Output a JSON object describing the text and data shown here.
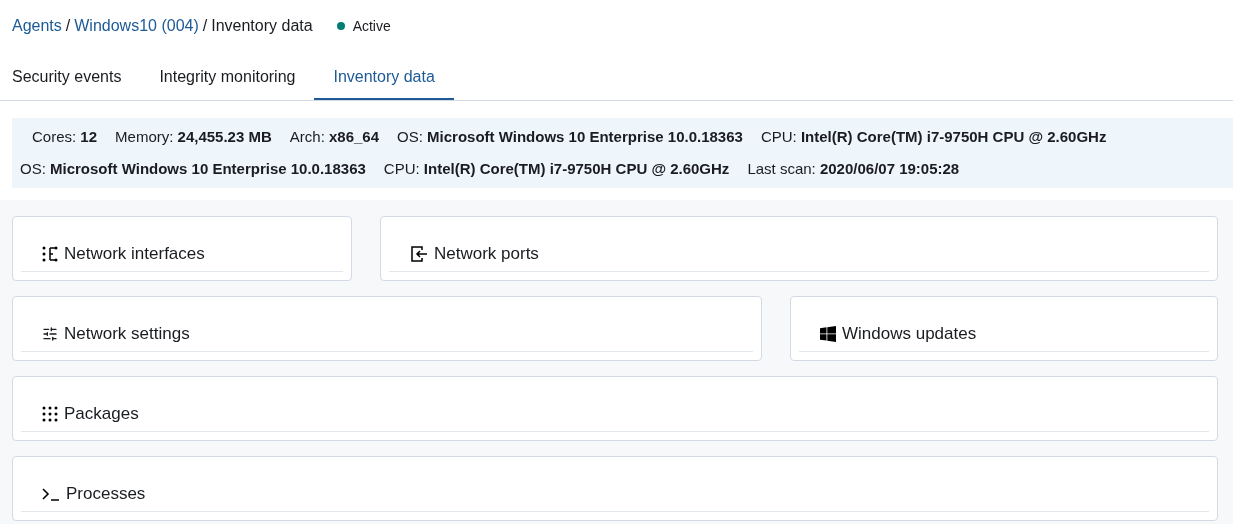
{
  "breadcrumb": [
    {
      "text": "Agents",
      "link": true
    },
    {
      "text": "/",
      "link": false
    },
    {
      "text": "Windows10 (004)",
      "link": true
    },
    {
      "text": "/",
      "link": false
    },
    {
      "text": "Inventory data",
      "link": false
    }
  ],
  "status": {
    "label": "Active"
  },
  "tabs": [
    {
      "label": "Security events",
      "selected": false
    },
    {
      "label": "Integrity monitoring",
      "selected": false
    },
    {
      "label": "Inventory data",
      "selected": true
    }
  ],
  "info_lines": [
    [
      {
        "label": "Cores:",
        "value": "12"
      },
      {
        "label": "Memory:",
        "value": "24,455.23 MB"
      },
      {
        "label": "Arch:",
        "value": "x86_64"
      },
      {
        "label": "OS:",
        "value": "Microsoft Windows 10 Enterprise 10.0.18363"
      },
      {
        "label": "CPU:",
        "value": "Intel(R) Core(TM) i7-9750H CPU @ 2.60GHz"
      }
    ],
    [
      {
        "label": "OS:",
        "value": "Microsoft Windows 10 Enterprise 10.0.18363"
      },
      {
        "label": "CPU:",
        "value": "Intel(R) Core(TM) i7-9750H CPU @ 2.60GHz"
      },
      {
        "label": "Last scan:",
        "value": "2020/06/07 19:05:28"
      }
    ]
  ],
  "card_rows": [
    [
      {
        "title": "Network interfaces",
        "kind": "interfaces"
      },
      {
        "title": "Network ports",
        "kind": "ports"
      }
    ],
    [
      {
        "title": "Network settings",
        "kind": "settings"
      },
      {
        "title": "Windows updates",
        "kind": "windows"
      }
    ],
    [
      {
        "title": "Packages",
        "kind": "packages"
      }
    ],
    [
      {
        "title": "Processes",
        "kind": "processes"
      }
    ]
  ]
}
